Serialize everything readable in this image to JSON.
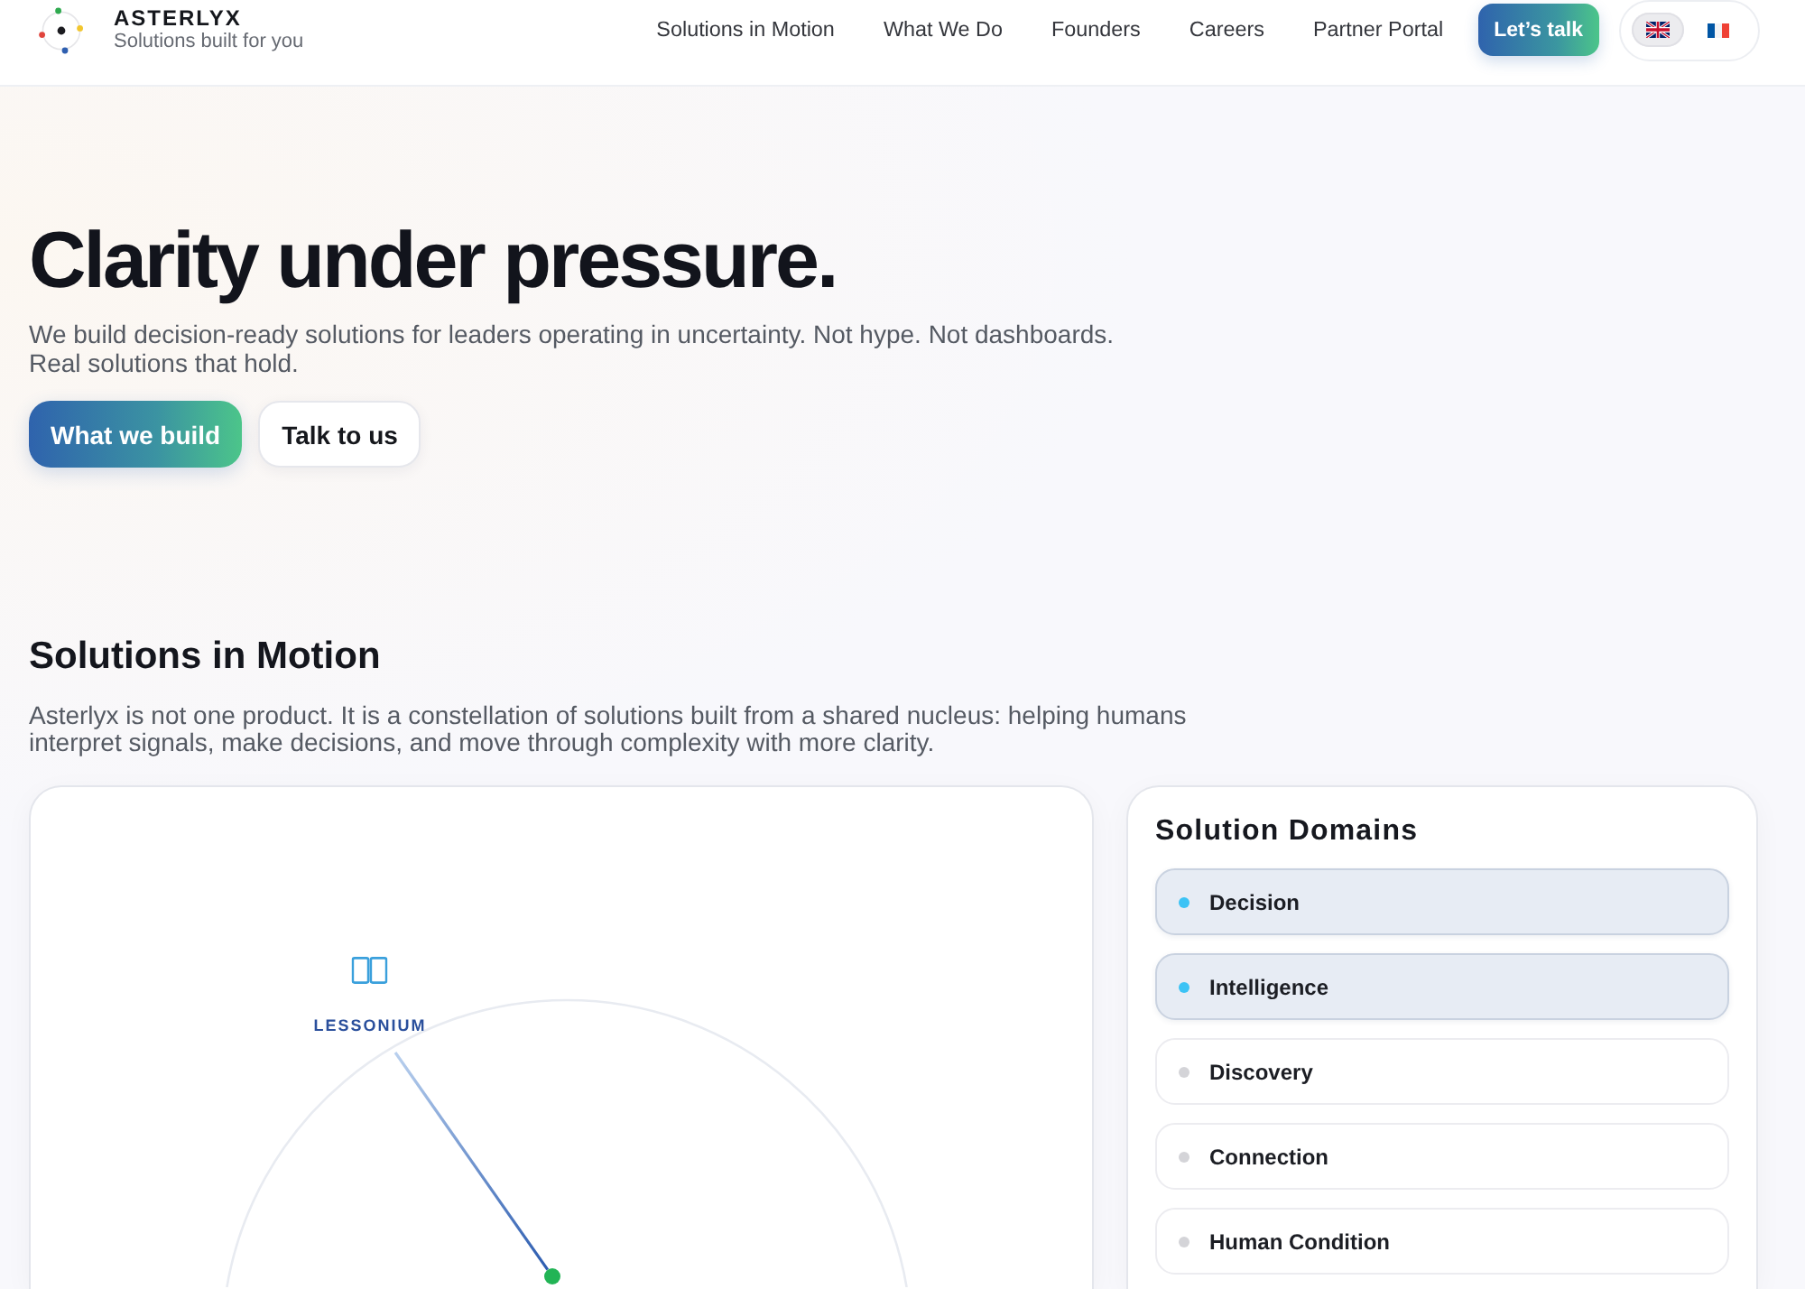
{
  "header": {
    "brand": {
      "name": "ASTERLYX",
      "tagline": "Solutions built for you"
    },
    "nav": [
      "Solutions in Motion",
      "What We Do",
      "Founders",
      "Careers",
      "Partner Portal"
    ],
    "cta": "Let’s talk",
    "languages": [
      {
        "kind": "gb",
        "selected": true
      },
      {
        "kind": "fr",
        "selected": false
      }
    ]
  },
  "hero": {
    "title": "Clarity under pressure.",
    "subtitle": "We build decision-ready solutions for leaders operating in uncertainty. Not hype. Not dashboards. Real solutions that hold.",
    "buttons": [
      {
        "label": "What we build",
        "kind": "primary"
      },
      {
        "label": "Talk to us",
        "kind": "secondary"
      }
    ]
  },
  "solutions": {
    "title": "Solutions in Motion",
    "intro": "Asterlyx is not one product. It is a constellation of solutions built from a shared nucleus: helping humans interpret signals, make decisions, and move through complexity with more clarity.",
    "diagram": {
      "nodes": [
        {
          "label": "LESSONIUM"
        }
      ]
    },
    "domains": {
      "title": "Solution Domains",
      "items": [
        {
          "label": "Decision",
          "selected": true
        },
        {
          "label": "Intelligence",
          "selected": true
        },
        {
          "label": "Discovery",
          "selected": false
        },
        {
          "label": "Connection",
          "selected": false
        },
        {
          "label": "Human Condition",
          "selected": false
        }
      ]
    }
  }
}
